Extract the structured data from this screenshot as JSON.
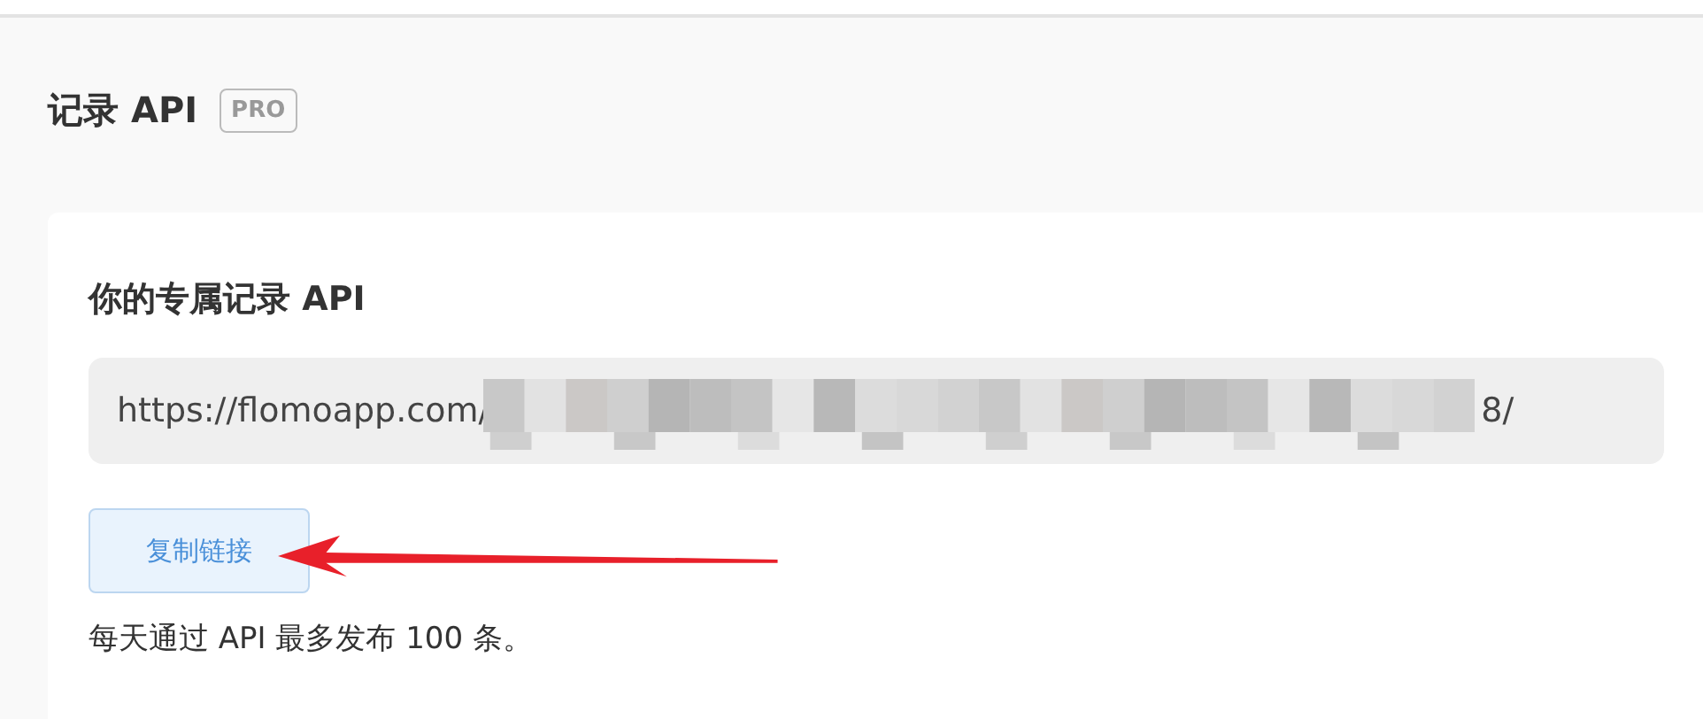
{
  "section": {
    "title": "记录 API",
    "badge": "PRO"
  },
  "card": {
    "title": "你的专属记录 API",
    "url_field": {
      "value_start": "https://flomoapp.com/",
      "value_end": "8/",
      "redacted": true
    },
    "copy_button": "复制链接",
    "note": "每天通过 API 最多发布 100 条。"
  }
}
